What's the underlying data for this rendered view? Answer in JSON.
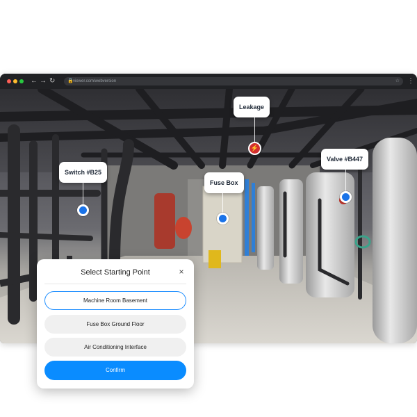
{
  "browser": {
    "url": "viewer.com/webversion",
    "nav": {
      "back": "←",
      "forward": "→",
      "reload": "↻",
      "menu": "⋮",
      "lock": "🔒",
      "star": "☆"
    },
    "traffic_colors": [
      "#ff5f57",
      "#febc2e",
      "#28c840"
    ]
  },
  "hotspots": {
    "leakage": {
      "label": "Leakage",
      "type": "alert",
      "icon": "lightning-icon",
      "color": "#d32f2f"
    },
    "switch": {
      "label": "Switch #B25",
      "icon": "pin-dot-icon",
      "color": "#1a73e8"
    },
    "fuse_box": {
      "label": "Fuse Box",
      "icon": "pin-dot-icon",
      "color": "#1a73e8"
    },
    "valve": {
      "label": "Valve #B447",
      "icon": "pin-dot-icon",
      "color": "#1a73e8"
    }
  },
  "dialog": {
    "title": "Select Starting Point",
    "close": "×",
    "options": [
      {
        "label": "Machine Room Basement",
        "selected": true
      },
      {
        "label": "Fuse Box Ground Floor",
        "selected": false
      },
      {
        "label": "Air Conditioning Interface",
        "selected": false
      }
    ],
    "confirm": "Confirm",
    "accent": "#0a8cff"
  }
}
